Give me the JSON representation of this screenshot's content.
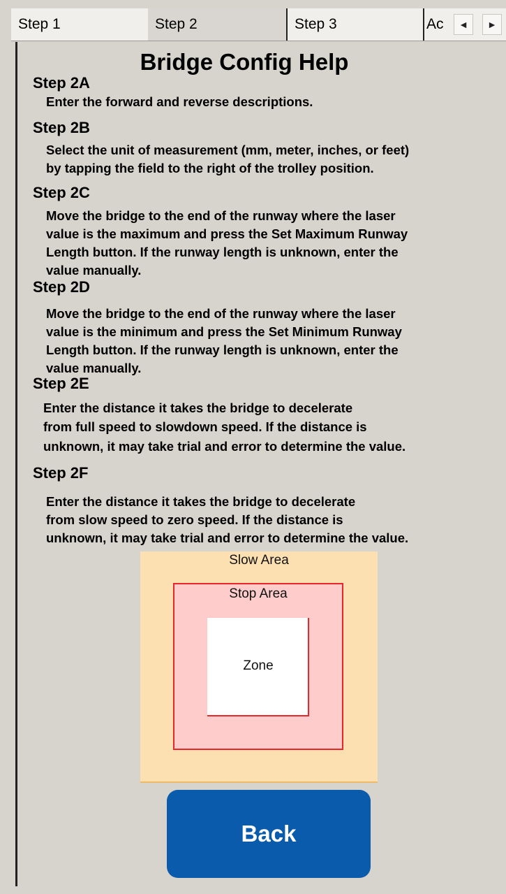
{
  "tabs": [
    {
      "label": "Step 1",
      "selected": false
    },
    {
      "label": "Step 2",
      "selected": true
    },
    {
      "label": "Step 3",
      "selected": false
    },
    {
      "label": "Ac",
      "selected": false
    }
  ],
  "scroll_buttons": {
    "left": "◄",
    "right": "►"
  },
  "help": {
    "title": "Bridge Config Help",
    "steps": [
      {
        "heading": "Step 2A",
        "lines": [
          "Enter the forward and reverse descriptions."
        ]
      },
      {
        "heading": "Step 2B",
        "lines": [
          "Select the unit of measurement (mm, meter, inches, or feet)",
          "by tapping the field to the right of the trolley position."
        ]
      },
      {
        "heading": "Step 2C",
        "lines": [
          "Move the bridge to the end of the runway where the laser",
          "value is the maximum and press the Set Maximum Runway",
          "Length button.  If the runway length is unknown, enter the",
          "value manually."
        ]
      },
      {
        "heading": "Step 2D",
        "lines": [
          "Move the bridge to the end of the runway where the laser",
          "value is the minimum and press the Set Minimum Runway",
          "Length button.  If the runway length is unknown, enter the",
          "value manually."
        ]
      },
      {
        "heading": "Step 2E",
        "lines": [
          "Enter the distance it takes the bridge to decelerate",
          "from full speed to slowdown speed.  If the distance is",
          "unknown, it may take trial and error to determine the value."
        ]
      },
      {
        "heading": "Step 2F",
        "lines": [
          "Enter the distance it takes the bridge to decelerate",
          "from slow speed to zero speed.  If the distance is",
          "unknown, it may take trial and error to determine the value."
        ]
      }
    ]
  },
  "diagram": {
    "slow_label": "Slow Area",
    "stop_label": "Stop Area",
    "zone_label": "Zone",
    "colors": {
      "slow": "#fde0b1",
      "stop": "#ffcccc",
      "stop_border": "#e8262c",
      "zone": "#ffffff"
    }
  },
  "back_button": {
    "label": "Back",
    "color": "#0a5bab"
  }
}
